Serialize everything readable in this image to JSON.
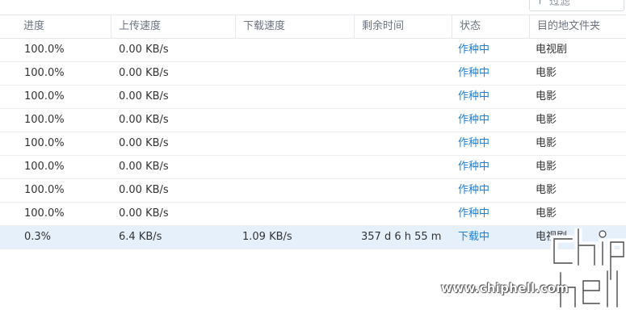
{
  "search": {
    "label": "过滤"
  },
  "columns": {
    "progress": "进度",
    "upload_speed": "上传速度",
    "download_speed": "下载速度",
    "remaining_time": "剩余时间",
    "status": "状态",
    "destination": "目的地文件夹"
  },
  "rows": [
    {
      "progress": "100.0%",
      "upload_speed": "0.00 KB/s",
      "download_speed": "",
      "remaining_time": "",
      "status": "作种中",
      "destination": "电视剧"
    },
    {
      "progress": "100.0%",
      "upload_speed": "0.00 KB/s",
      "download_speed": "",
      "remaining_time": "",
      "status": "作种中",
      "destination": "电影"
    },
    {
      "progress": "100.0%",
      "upload_speed": "0.00 KB/s",
      "download_speed": "",
      "remaining_time": "",
      "status": "作种中",
      "destination": "电影"
    },
    {
      "progress": "100.0%",
      "upload_speed": "0.00 KB/s",
      "download_speed": "",
      "remaining_time": "",
      "status": "作种中",
      "destination": "电影"
    },
    {
      "progress": "100.0%",
      "upload_speed": "0.00 KB/s",
      "download_speed": "",
      "remaining_time": "",
      "status": "作种中",
      "destination": "电影"
    },
    {
      "progress": "100.0%",
      "upload_speed": "0.00 KB/s",
      "download_speed": "",
      "remaining_time": "",
      "status": "作种中",
      "destination": "电影"
    },
    {
      "progress": "100.0%",
      "upload_speed": "0.00 KB/s",
      "download_speed": "",
      "remaining_time": "",
      "status": "作种中",
      "destination": "电影"
    },
    {
      "progress": "100.0%",
      "upload_speed": "0.00 KB/s",
      "download_speed": "",
      "remaining_time": "",
      "status": "作种中",
      "destination": "电影"
    },
    {
      "progress": "0.3%",
      "upload_speed": "6.4 KB/s",
      "download_speed": "1.09 KB/s",
      "remaining_time": "357 d 6 h 55 m",
      "status": "下载中",
      "destination": "电视剧",
      "selected": true
    }
  ],
  "watermark": {
    "url": "www.chiphell.com",
    "logo_text": "chip hell"
  },
  "colors": {
    "status_link": "#1f7fd1",
    "selected_row": "#e6f0fb",
    "border": "#e5e8ec",
    "header_text": "#6b7480"
  }
}
